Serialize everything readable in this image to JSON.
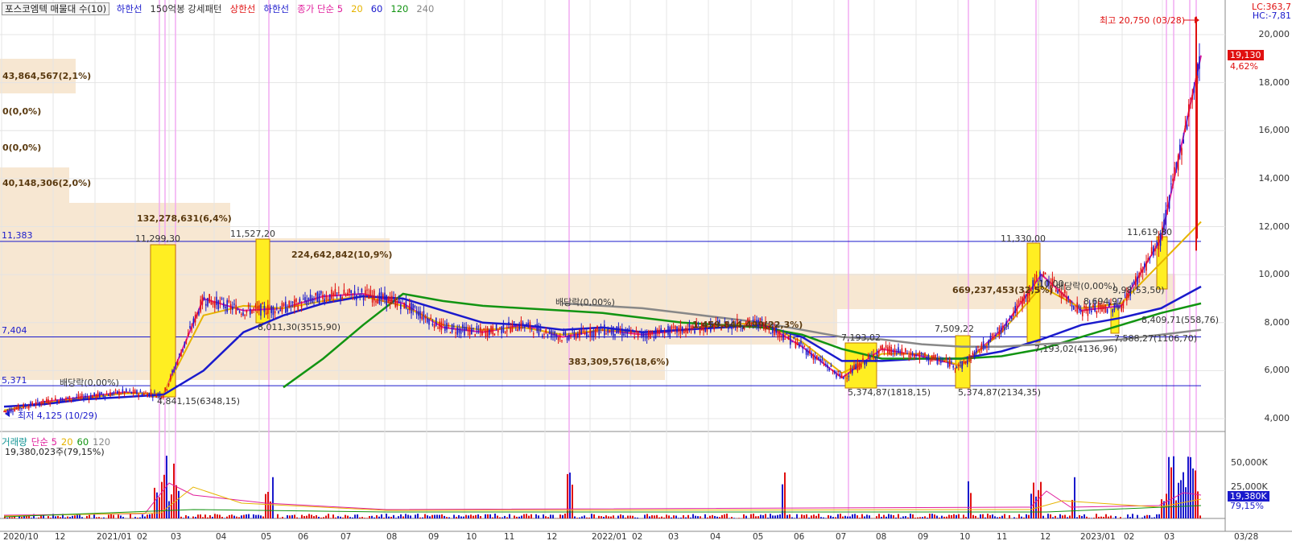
{
  "header": {
    "title_box": "포스코엠텍 매물대 수(10)",
    "items": [
      {
        "text": "하한선",
        "color": "#1a1acc"
      },
      {
        "text": "150억봉 강세패턴",
        "color": "#333333"
      },
      {
        "text": "상한선",
        "color": "#e01010"
      },
      {
        "text": "하한선",
        "color": "#1a1acc"
      },
      {
        "text": "종가 단순 5",
        "color": "#e01e9c"
      },
      {
        "text": "20",
        "color": "#e6b400"
      },
      {
        "text": "60",
        "color": "#1a1acc"
      },
      {
        "text": "120",
        "color": "#129412"
      },
      {
        "text": "240",
        "color": "#888888"
      }
    ],
    "right_top_1": "LC:363,7",
    "right_top_2": "HC:-7,81"
  },
  "volume_profile": [
    {
      "label": "43,864,567(2,1%)"
    },
    {
      "label": "0(0,0%)"
    },
    {
      "label": "0(0,0%)"
    },
    {
      "label": "40,148,306(2,0%)"
    },
    {
      "label": "132,278,631(6,4%)"
    },
    {
      "label": "224,642,842(10,9%)"
    },
    {
      "label": "669,237,453(32,5%)"
    },
    {
      "label": "1,459,844,499(22,3%)"
    },
    {
      "label": "383,309,576(18,6%)"
    }
  ],
  "levels": [
    {
      "label": "11,383",
      "value": 11383
    },
    {
      "label": "7,404",
      "value": 7404
    },
    {
      "label": "5,371",
      "value": 5371
    }
  ],
  "annotations": {
    "high": "최고 20,750 (03/28)",
    "low": "최저 4,125 (10/29)",
    "dividend_1": "배당락(0,00%)",
    "dividend_2": "배당락(0,00%)",
    "dividend_3": "배당락(0,00%)",
    "p1": "11,299,30",
    "p2": "11,527,20",
    "p3": "11,330,00",
    "p4": "11,619,80",
    "p5": "7,193,02",
    "p6": "7,509,22",
    "p7": "8,011,30(3515,90)",
    "p8": "5,374,87(1818,15)",
    "p9": "5,374,87(2134,35)",
    "p10": "7,193,02(4136,96)",
    "p11": "4,841,15(6348,15)",
    "p12": "8,694,97",
    "p13": "9,98(53,50)",
    "p14": "7,588,27(1106,70)",
    "p15": "8,409,71(558,76)",
    "p16": "10,00"
  },
  "price_tag": {
    "value": "19,130",
    "pct": "4,62%"
  },
  "volume_panel": {
    "legend": [
      {
        "text": "거래량",
        "color": "#129494"
      },
      {
        "text": "단순 5",
        "color": "#e01e9c"
      },
      {
        "text": "20",
        "color": "#e6b400"
      },
      {
        "text": "60",
        "color": "#129412"
      },
      {
        "text": "120",
        "color": "#888888"
      }
    ],
    "last": "19,380,023주(79,15%)",
    "tag": "19,380K",
    "tag_pct": "79,15%",
    "ticks": [
      "50,000K",
      "25,000K"
    ]
  },
  "x_axis": [
    "2020/10",
    "12",
    "2021/01",
    "02",
    "03",
    "04",
    "05",
    "06",
    "07",
    "08",
    "09",
    "10",
    "11",
    "12",
    "2022/01",
    "02",
    "03",
    "04",
    "05",
    "06",
    "07",
    "08",
    "09",
    "10",
    "11",
    "12",
    "2023/01",
    "02",
    "03",
    "03/28"
  ],
  "colors": {
    "up": "#e01010",
    "down": "#1a1acc",
    "ma5": "#e01e9c",
    "ma20": "#e6b400",
    "ma60": "#1a1acc",
    "ma120": "#129412",
    "ma240": "#888888",
    "box": "#f7e7d2",
    "highlight": "#ffee22"
  },
  "chart_data": {
    "type": "line",
    "title": "포스코엠텍 매물대 수(10)",
    "y_ticks": [
      4000,
      6000,
      8000,
      10000,
      12000,
      14000,
      16000,
      18000,
      20000
    ],
    "ylim": [
      3800,
      21000
    ],
    "x": [
      "2020/10",
      "2020/11",
      "2020/12",
      "2021/01",
      "2021/02",
      "2021/03",
      "2021/04",
      "2021/05",
      "2021/06",
      "2021/07",
      "2021/08",
      "2021/09",
      "2021/10",
      "2021/11",
      "2021/12",
      "2022/01",
      "2022/02",
      "2022/03",
      "2022/04",
      "2022/05",
      "2022/06",
      "2022/07",
      "2022/08",
      "2022/09",
      "2022/10",
      "2022/11",
      "2022/12",
      "2023/01",
      "2023/02",
      "2023/03",
      "2023/03/28"
    ],
    "series": [
      {
        "name": "5",
        "values": [
          4300,
          4700,
          4900,
          5100,
          5000,
          9000,
          8500,
          8600,
          9100,
          9200,
          8800,
          7800,
          7600,
          7900,
          7400,
          7700,
          7500,
          7700,
          7900,
          8000,
          7000,
          5700,
          6900,
          6600,
          6200,
          7700,
          10000,
          8500,
          8700,
          11500,
          19130
        ]
      },
      {
        "name": "20",
        "values": [
          4350,
          4650,
          4850,
          5050,
          5050,
          8300,
          8700,
          8600,
          8900,
          9100,
          8700,
          7900,
          7700,
          7800,
          7500,
          7700,
          7600,
          7700,
          7900,
          8000,
          7200,
          5900,
          6700,
          6700,
          6200,
          7600,
          9500,
          8600,
          8800,
          10500,
          12200
        ]
      },
      {
        "name": "60",
        "values": [
          4500,
          4600,
          4800,
          4900,
          5000,
          6000,
          7600,
          8300,
          8800,
          9100,
          9000,
          8500,
          8000,
          7900,
          7700,
          7800,
          7600,
          7700,
          7800,
          7900,
          7400,
          6400,
          6400,
          6500,
          6500,
          6800,
          7300,
          7900,
          8200,
          8600,
          9500
        ]
      },
      {
        "name": "120",
        "values": [
          null,
          null,
          null,
          null,
          null,
          null,
          null,
          5300,
          6500,
          7900,
          9200,
          8900,
          8700,
          8600,
          8500,
          8400,
          8200,
          8000,
          7900,
          7800,
          7500,
          6900,
          6500,
          6500,
          6500,
          6600,
          6900,
          7400,
          7900,
          8400,
          8800
        ]
      },
      {
        "name": "240",
        "values": [
          null,
          null,
          null,
          null,
          null,
          null,
          null,
          null,
          null,
          null,
          null,
          null,
          null,
          null,
          8800,
          8700,
          8600,
          8400,
          8200,
          8000,
          7700,
          7400,
          7300,
          7100,
          7000,
          7000,
          7100,
          7200,
          7300,
          7500,
          7700
        ]
      }
    ]
  }
}
